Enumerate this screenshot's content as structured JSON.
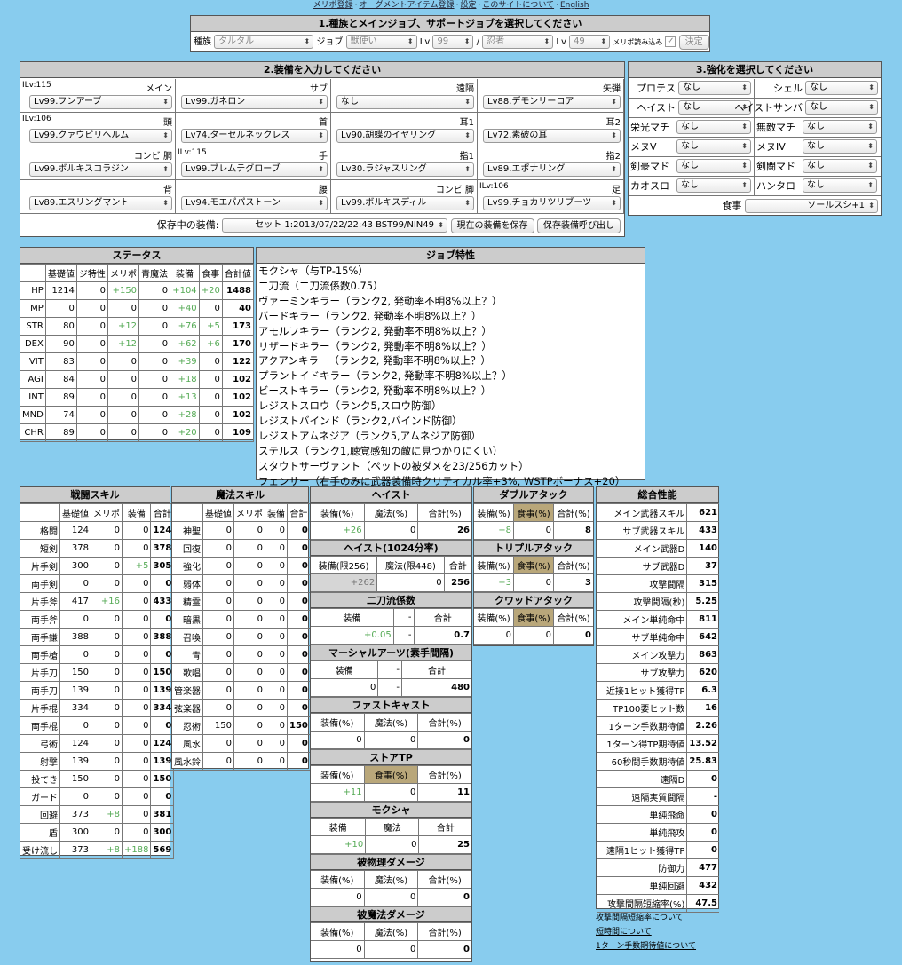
{
  "top_links": [
    "メリポ登録",
    "オーグメントアイテム登録",
    "設定",
    "このサイトについて",
    "English"
  ],
  "race_panel": {
    "title": "1.種族とメインジョブ、サポートジョブを選択してください",
    "race_label": "種族",
    "race_value": "タルタル",
    "job_label": "ジョブ",
    "main_job": "獣使い",
    "lv_label": "Lv",
    "main_lv": "99",
    "slash": "/",
    "sub_job": "忍者",
    "sub_lv": "49",
    "merit_label": "メリポ読み込み",
    "decide": "決定"
  },
  "equip_panel": {
    "title": "2.装備を入力してください",
    "slots": [
      {
        "ilv": "ILv:115",
        "name": "メイン",
        "value": "Lv99.フンアーブ"
      },
      {
        "ilv": "",
        "name": "サブ",
        "value": "Lv99.ガネロン"
      },
      {
        "ilv": "",
        "name": "遠隔",
        "value": "なし"
      },
      {
        "ilv": "",
        "name": "矢弾",
        "value": "Lv88.デモンリーコア"
      },
      {
        "ilv": "ILv:106",
        "name": "頭",
        "value": "Lv99.クァウピリヘルム"
      },
      {
        "ilv": "",
        "name": "首",
        "value": "Lv74.ターセルネックレス"
      },
      {
        "ilv": "",
        "name": "耳1",
        "value": "Lv90.胡蝶のイヤリング"
      },
      {
        "ilv": "",
        "name": "耳2",
        "value": "Lv72.素破の耳"
      },
      {
        "ilv": "",
        "name": "コンビ 胴",
        "value": "Lv99.ボルキスコラジン"
      },
      {
        "ilv": "ILv:115",
        "name": "手",
        "value": "Lv99.ブレムテグローブ"
      },
      {
        "ilv": "",
        "name": "指1",
        "value": "Lv30.ラジャスリング"
      },
      {
        "ilv": "",
        "name": "指2",
        "value": "Lv89.エポナリング"
      },
      {
        "ilv": "",
        "name": "背",
        "value": "Lv89.エスリングマント"
      },
      {
        "ilv": "",
        "name": "腰",
        "value": "Lv94.モエパパストーン"
      },
      {
        "ilv": "",
        "name": "コンビ 脚",
        "value": "Lv99.ボルキスディル"
      },
      {
        "ilv": "ILv:106",
        "name": "足",
        "value": "Lv99.チョカリツリブーツ"
      }
    ],
    "saved_label": "保存中の装備:",
    "saved_value": "セット 1:2013/07/22/22:43 BST99/NIN49",
    "save_btn": "現在の装備を保存",
    "load_btn": "保存装備呼び出し"
  },
  "enhance_panel": {
    "title": "3.強化を選択してください",
    "rows": [
      [
        {
          "label": "プロテス",
          "value": "なし"
        },
        {
          "label": "シェル",
          "value": "なし"
        }
      ],
      [
        {
          "label": "ヘイスト",
          "value": "なし"
        },
        {
          "label": "ヘイストサンバ",
          "value": "なし"
        }
      ],
      [
        {
          "label": "栄光マチ",
          "value": "なし"
        },
        {
          "label": "無敵マチ",
          "value": "なし"
        }
      ],
      [
        {
          "label": "メヌV",
          "value": "なし"
        },
        {
          "label": "メヌIV",
          "value": "なし"
        }
      ],
      [
        {
          "label": "剣豪マド",
          "value": "なし"
        },
        {
          "label": "剣闘マド",
          "value": "なし"
        }
      ],
      [
        {
          "label": "カオスロ",
          "value": "なし"
        },
        {
          "label": "ハンタロ",
          "value": "なし"
        }
      ]
    ],
    "food_label": "食事",
    "food_value": "ソールスシ+1"
  },
  "status": {
    "title": "ステータス",
    "headers": [
      "基礎値",
      "ジ特性",
      "メリポ",
      "青魔法",
      "装備",
      "食事",
      "合計値"
    ],
    "rows": [
      [
        "HP",
        "1214",
        "0",
        "+150",
        "0",
        "+104",
        "+20",
        "1488"
      ],
      [
        "MP",
        "0",
        "0",
        "0",
        "0",
        "+40",
        "0",
        "40"
      ],
      [
        "STR",
        "80",
        "0",
        "+12",
        "0",
        "+76",
        "+5",
        "173"
      ],
      [
        "DEX",
        "90",
        "0",
        "+12",
        "0",
        "+62",
        "+6",
        "170"
      ],
      [
        "VIT",
        "83",
        "0",
        "0",
        "0",
        "+39",
        "0",
        "122"
      ],
      [
        "AGI",
        "84",
        "0",
        "0",
        "0",
        "+18",
        "0",
        "102"
      ],
      [
        "INT",
        "89",
        "0",
        "0",
        "0",
        "+13",
        "0",
        "102"
      ],
      [
        "MND",
        "74",
        "0",
        "0",
        "0",
        "+28",
        "0",
        "102"
      ],
      [
        "CHR",
        "89",
        "0",
        "0",
        "0",
        "+20",
        "0",
        "109"
      ]
    ]
  },
  "job_traits": {
    "title": "ジョブ特性",
    "items": [
      "モクシャ（与TP-15%）",
      "二刀流（二刀流係数0.75）",
      "ヴァーミンキラー（ランク2, 発動率不明8%以上？）",
      "バードキラー（ランク2, 発動率不明8%以上？）",
      "アモルフキラー（ランク2, 発動率不明8%以上？）",
      "リザードキラー（ランク2, 発動率不明8%以上？）",
      "アクアンキラー（ランク2, 発動率不明8%以上？）",
      "プラントイドキラー（ランク2, 発動率不明8%以上？）",
      "ビーストキラー（ランク2, 発動率不明8%以上？）",
      "レジストスロウ（ランク5,スロウ防御）",
      "レジストバインド（ランク2,バインド防御）",
      "レジストアムネジア（ランク5,アムネジア防御）",
      "ステルス（ランク1,聴覚感知の敵に見つかりにくい）",
      "スタウトサーヴァント（ペットの被ダメを23/256カット）",
      "フェンサー（右手のみに武器装備時クリティカル率+3%, WSTPボーナス+20）"
    ]
  },
  "combat_skill": {
    "title": "戦闘スキル",
    "headers": [
      "基礎値",
      "メリポ",
      "装備",
      "合計"
    ],
    "rows": [
      [
        "格闘",
        "124",
        "0",
        "0",
        "124"
      ],
      [
        "短剣",
        "378",
        "0",
        "0",
        "378"
      ],
      [
        "片手剣",
        "300",
        "0",
        "+5",
        "305"
      ],
      [
        "両手剣",
        "0",
        "0",
        "0",
        "0"
      ],
      [
        "片手斧",
        "417",
        "+16",
        "0",
        "433"
      ],
      [
        "両手斧",
        "0",
        "0",
        "0",
        "0"
      ],
      [
        "両手鎌",
        "388",
        "0",
        "0",
        "388"
      ],
      [
        "両手槍",
        "0",
        "0",
        "0",
        "0"
      ],
      [
        "片手刀",
        "150",
        "0",
        "0",
        "150"
      ],
      [
        "両手刀",
        "139",
        "0",
        "0",
        "139"
      ],
      [
        "片手棍",
        "334",
        "0",
        "0",
        "334"
      ],
      [
        "両手棍",
        "0",
        "0",
        "0",
        "0"
      ],
      [
        "弓術",
        "124",
        "0",
        "0",
        "124"
      ],
      [
        "射撃",
        "139",
        "0",
        "0",
        "139"
      ],
      [
        "投てき",
        "150",
        "0",
        "0",
        "150"
      ],
      [
        "ガード",
        "0",
        "0",
        "0",
        "0"
      ],
      [
        "回避",
        "373",
        "+8",
        "0",
        "381"
      ],
      [
        "盾",
        "300",
        "0",
        "0",
        "300"
      ],
      [
        "受け流し",
        "373",
        "+8",
        "+188",
        "569"
      ]
    ]
  },
  "magic_skill": {
    "title": "魔法スキル",
    "headers": [
      "基礎値",
      "メリポ",
      "装備",
      "合計"
    ],
    "rows": [
      [
        "神聖",
        "0",
        "0",
        "0",
        "0"
      ],
      [
        "回復",
        "0",
        "0",
        "0",
        "0"
      ],
      [
        "強化",
        "0",
        "0",
        "0",
        "0"
      ],
      [
        "弱体",
        "0",
        "0",
        "0",
        "0"
      ],
      [
        "精霊",
        "0",
        "0",
        "0",
        "0"
      ],
      [
        "暗黒",
        "0",
        "0",
        "0",
        "0"
      ],
      [
        "召喚",
        "0",
        "0",
        "0",
        "0"
      ],
      [
        "青",
        "0",
        "0",
        "0",
        "0"
      ],
      [
        "歌唱",
        "0",
        "0",
        "0",
        "0"
      ],
      [
        "管楽器",
        "0",
        "0",
        "0",
        "0"
      ],
      [
        "弦楽器",
        "0",
        "0",
        "0",
        "0"
      ],
      [
        "忍術",
        "150",
        "0",
        "0",
        "150"
      ],
      [
        "風水",
        "0",
        "0",
        "0",
        "0"
      ],
      [
        "風水鈴",
        "0",
        "0",
        "0",
        "0"
      ]
    ]
  },
  "haste": {
    "title": "ヘイスト",
    "headers": [
      "装備(%)",
      "魔法(%)",
      "合計(%)"
    ],
    "values": [
      "+26",
      "0",
      "26"
    ]
  },
  "haste1024": {
    "title": "ヘイスト(1024分率)",
    "headers": [
      "装備(限256)",
      "魔法(限448)",
      "合計"
    ],
    "values": [
      "+262",
      "0",
      "256"
    ]
  },
  "dual_wield": {
    "title": "二刀流係数",
    "headers": [
      "装備",
      "-",
      "合計"
    ],
    "values": [
      "+0.05",
      "-",
      "0.7"
    ]
  },
  "martial": {
    "title": "マーシャルアーツ(素手間隔)",
    "headers": [
      "装備",
      "-",
      "合計"
    ],
    "values": [
      "0",
      "-",
      "480"
    ]
  },
  "fast_cast": {
    "title": "ファストキャスト",
    "headers": [
      "装備(%)",
      "魔法(%)",
      "合計(%)"
    ],
    "values": [
      "0",
      "0",
      "0"
    ]
  },
  "store_tp": {
    "title": "ストアTP",
    "headers": [
      "装備(%)",
      "食事(%)",
      "合計(%)"
    ],
    "values": [
      "+11",
      "0",
      "11"
    ]
  },
  "moksha": {
    "title": "モクシャ",
    "headers": [
      "装備",
      "魔法",
      "合計"
    ],
    "values": [
      "+10",
      "0",
      "25"
    ]
  },
  "phys_dmg": {
    "title": "被物理ダメージ",
    "headers": [
      "装備(%)",
      "魔法(%)",
      "合計(%)"
    ],
    "values": [
      "0",
      "0",
      "0"
    ]
  },
  "mag_dmg": {
    "title": "被魔法ダメージ",
    "headers": [
      "装備(%)",
      "魔法(%)",
      "合計(%)"
    ],
    "values": [
      "0",
      "0",
      "0"
    ]
  },
  "double_attack": {
    "title": "ダブルアタック",
    "headers": [
      "装備(%)",
      "食事(%)",
      "合計(%)"
    ],
    "values": [
      "+8",
      "0",
      "8"
    ]
  },
  "triple_attack": {
    "title": "トリプルアタック",
    "headers": [
      "装備(%)",
      "食事(%)",
      "合計(%)"
    ],
    "values": [
      "+3",
      "0",
      "3"
    ]
  },
  "quad_attack": {
    "title": "クワッドアタック",
    "headers": [
      "装備(%)",
      "食事(%)",
      "合計(%)"
    ],
    "values": [
      "0",
      "0",
      "0"
    ]
  },
  "overall": {
    "title": "総合性能",
    "rows": [
      [
        "メイン武器スキル",
        "621"
      ],
      [
        "サブ武器スキル",
        "433"
      ],
      [
        "メイン武器D",
        "140"
      ],
      [
        "サブ武器D",
        "37"
      ],
      [
        "攻撃間隔",
        "315"
      ],
      [
        "攻撃間隔(秒)",
        "5.25"
      ],
      [
        "メイン単純命中",
        "811"
      ],
      [
        "サブ単純命中",
        "642"
      ],
      [
        "メイン攻撃力",
        "863"
      ],
      [
        "サブ攻撃力",
        "620"
      ],
      [
        "近接1ヒット獲得TP",
        "6.3"
      ],
      [
        "TP100要ヒット数",
        "16"
      ],
      [
        "1ターン手数期待値",
        "2.26"
      ],
      [
        "1ターン得TP期待値",
        "13.52"
      ],
      [
        "60秒間手数期待値",
        "25.83"
      ],
      [
        "遠隔D",
        "0"
      ],
      [
        "遠隔実質間隔",
        "-"
      ],
      [
        "単純飛命",
        "0"
      ],
      [
        "単純飛攻",
        "0"
      ],
      [
        "遠隔1ヒット獲得TP",
        "0"
      ],
      [
        "防御力",
        "477"
      ],
      [
        "単純回避",
        "432"
      ],
      [
        "攻撃間隔短縮率(%)",
        "47.5"
      ]
    ],
    "links": [
      "攻撃間隔短縮率について",
      "短時間について",
      "1ターン手数期待値について"
    ]
  }
}
